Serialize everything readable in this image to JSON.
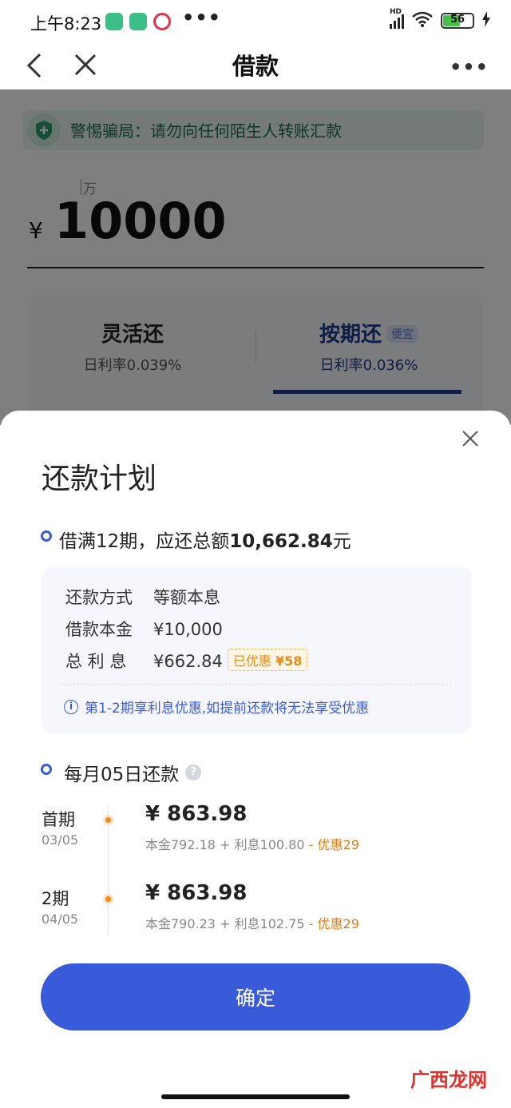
{
  "status_bar": {
    "time": "上午8:23",
    "more_dots": "•••",
    "network": "HD",
    "battery": "56",
    "battery_level": 0.56
  },
  "nav": {
    "title": "借款",
    "more_dots": "•••"
  },
  "background": {
    "warning": "警惕骗局：请勿向任何陌生人转账汇款",
    "amount_unit": "万",
    "currency": "¥",
    "amount": "10000",
    "tabs": [
      {
        "title": "灵活还",
        "rate": "日利率0.039%",
        "badge": ""
      },
      {
        "title": "按期还",
        "rate": "日利率0.036%",
        "badge": "便宜"
      }
    ]
  },
  "sheet": {
    "title": "还款计划",
    "summary_prefix": "借满12期，应还总额",
    "summary_amount": "10,662.84",
    "summary_suffix": "元",
    "details": [
      {
        "label": "还款方式",
        "value": "等额本息"
      },
      {
        "label": "借款本金",
        "value": "¥10,000"
      },
      {
        "label": "总 利 息",
        "value": "¥662.84"
      }
    ],
    "saved_badge_text": "已优惠",
    "saved_badge_amount": "¥58",
    "notice": "第1-2期享利息优惠,如提前还款将无法享受优惠",
    "monthly_label": "每月05日还款",
    "terms": [
      {
        "name": "首期",
        "date": "03/05",
        "amount": "¥ 863.98",
        "principal": "本金792.18 + 利息100.80",
        "discount": " - 优惠29"
      },
      {
        "name": "2期",
        "date": "04/05",
        "amount": "¥ 863.98",
        "principal": "本金790.23 + 利息102.75",
        "discount": " - 优惠29"
      }
    ],
    "confirm": "确定"
  },
  "watermark": "广西龙网",
  "colors": {
    "primary": "#3a5bd9",
    "navy": "#1e3a8a",
    "orange": "#f08a24",
    "green": "#1f6b4e"
  }
}
